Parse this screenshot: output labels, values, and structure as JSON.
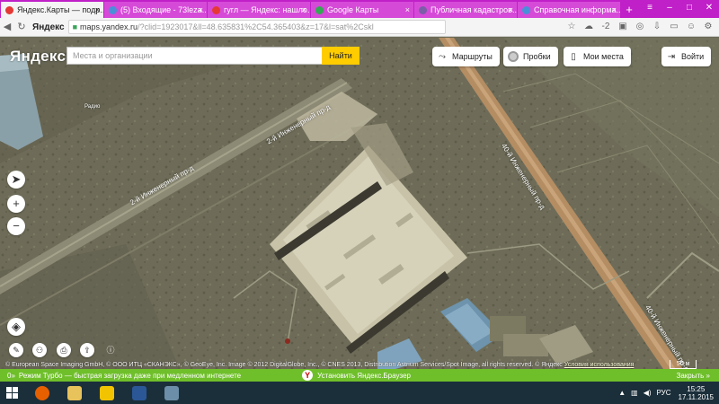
{
  "browser": {
    "tabs": [
      {
        "title": "Яндекс.Карты — подр...",
        "active": true,
        "favicon_color": "#e53935"
      },
      {
        "title": "(5) Входящие - 73leza...",
        "active": false,
        "favicon_color": "#4a90d9"
      },
      {
        "title": "гугл — Яндекс: нашло...",
        "active": false,
        "favicon_color": "#e53935"
      },
      {
        "title": "Google Карты",
        "active": false,
        "favicon_color": "#34a853"
      },
      {
        "title": "Публичная кадастров...",
        "active": false,
        "favicon_color": "#7b5ea7"
      },
      {
        "title": "Справочная информа...",
        "active": false,
        "favicon_color": "#4a90d9"
      }
    ],
    "brand": "Яндекс",
    "url_domain": "maps.yandex.ru",
    "url_path": "/?clid=1923017&ll=48.635831%2C54.365403&z=17&l=sat%2Cskl",
    "weather": "-2"
  },
  "map": {
    "logo": "Яндекс",
    "search_placeholder": "Места и организации",
    "search_button": "Найти",
    "routes_label": "Маршруты",
    "traffic_label": "Пробки",
    "places_label": "Мои места",
    "login_label": "Войти",
    "road_label_1": "2-й Инженерный пр-д",
    "road_label_2": "2-й Инженерный пр-д",
    "road_label_3": "40-й Инженерный пр-д",
    "road_label_4": "40-й Инженерный пр-д",
    "road_label_5": "Радио",
    "copyright": "© European Space Imaging GmbH, © ООО ИТЦ «СКАНЭКС», © GeoEye, Inc. Image © 2012 DigitalGlobe, Inc., © CNES 2013, Distribution Astrium Services/Spot Image, all rights reserved. © Яндекс",
    "terms": "Условия использования",
    "scale": "50 м"
  },
  "turbo": {
    "prefix": "0»",
    "message": "Режим Турбо — быстрая загрузка даже при медленном интернете",
    "install": "Установить Яндекс.Браузер",
    "close": "Закрыть »"
  },
  "taskbar": {
    "lang": "РУС",
    "time": "15:25",
    "date": "17.11.2015"
  }
}
